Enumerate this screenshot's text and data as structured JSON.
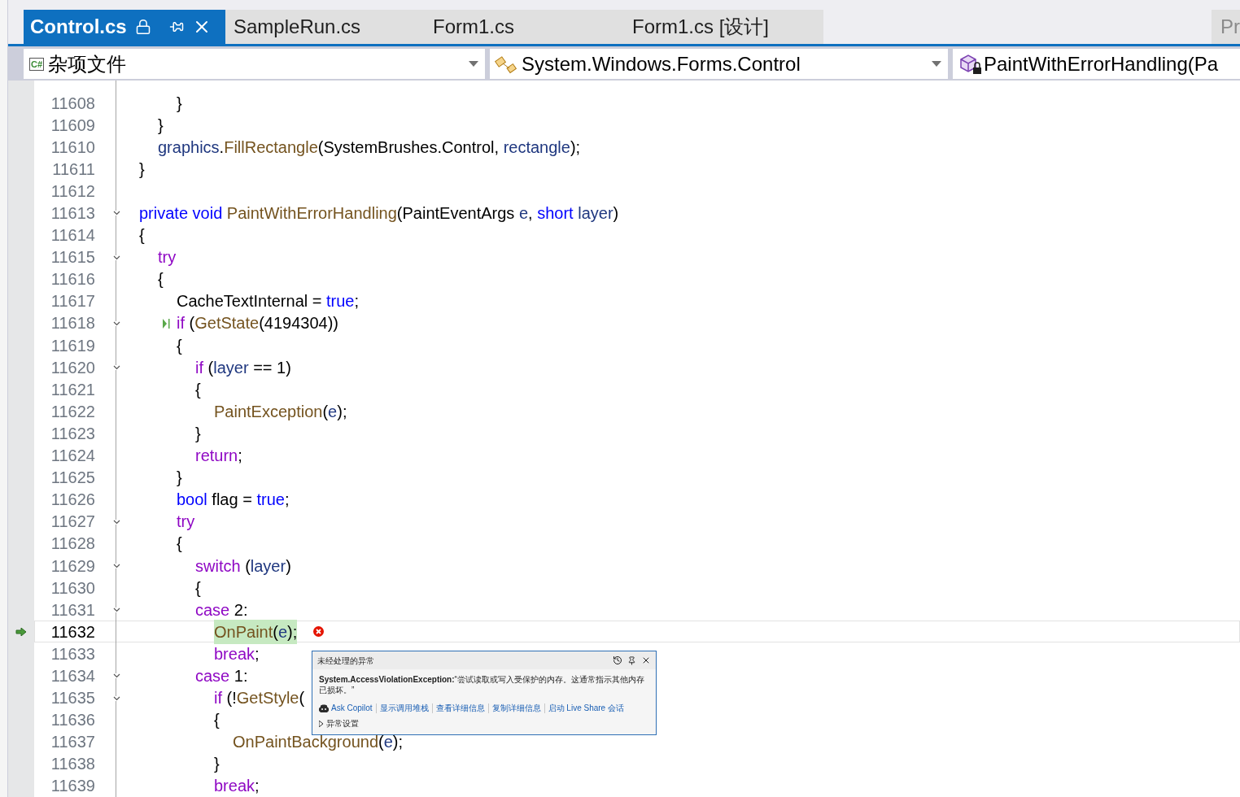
{
  "tabs": [
    {
      "label": "Control.cs",
      "selected": true
    },
    {
      "label": "SampleRun.cs",
      "selected": false
    },
    {
      "label": "Form1.cs",
      "selected": false
    },
    {
      "label": "Form1.cs [设计]",
      "selected": false
    }
  ],
  "side_tab": {
    "label": "Pr"
  },
  "nav_bar": {
    "project_badge": "C#",
    "project": "杂项文件",
    "type": "System.Windows.Forms.Control",
    "member": "PaintWithErrorHandling(Pa"
  },
  "lines": [
    {
      "children": [
        {
          "children": [
            {
              "number": "11608",
              "foldable": false,
              "current": false,
              "step_marker": false,
              "tokens": [
                {
                  "kind": "plain",
                  "text": "}"
                }
              ]
            }
          ]
        },
        {
          "number": "11609",
          "foldable": false,
          "current": false,
          "step_marker": false,
          "tokens": [
            {
              "kind": "plain",
              "text": "}"
            }
          ]
        },
        {
          "number": "11610",
          "foldable": false,
          "current": false,
          "step_marker": false,
          "tokens": [
            {
              "kind": "param",
              "text": "graphics"
            },
            {
              "kind": "plain",
              "text": "."
            },
            {
              "kind": "fn",
              "text": "FillRectangle"
            },
            {
              "kind": "plain",
              "text": "(SystemBrushes.Control, "
            },
            {
              "kind": "param",
              "text": "rectangle"
            },
            {
              "kind": "plain",
              "text": ");"
            }
          ]
        }
      ]
    },
    {
      "number": "11611",
      "foldable": false,
      "current": false,
      "step_marker": false,
      "tokens": [
        {
          "kind": "plain",
          "text": "}"
        }
      ]
    },
    {
      "number": "11612",
      "foldable": false,
      "current": false,
      "step_marker": false
    },
    {
      "number": "11613",
      "foldable": true,
      "current": false,
      "step_marker": false,
      "tokens": [
        {
          "kind": "kw",
          "text": "private void "
        },
        {
          "kind": "fn",
          "text": "PaintWithErrorHandling"
        },
        {
          "kind": "plain",
          "text": "(PaintEventArgs "
        },
        {
          "kind": "param",
          "text": "e"
        },
        {
          "kind": "plain",
          "text": ", "
        },
        {
          "kind": "kw",
          "text": "short "
        },
        {
          "kind": "param",
          "text": "layer"
        },
        {
          "kind": "plain",
          "text": ")"
        }
      ]
    },
    {
      "number": "11614",
      "foldable": false,
      "current": false,
      "step_marker": false,
      "tokens": [
        {
          "kind": "plain",
          "text": "{"
        }
      ],
      "children": [
        {
          "number": "11615",
          "foldable": true,
          "current": false,
          "step_marker": false,
          "tokens": [
            {
              "kind": "ctl",
              "text": "try"
            }
          ]
        },
        {
          "number": "11616",
          "foldable": false,
          "current": false,
          "step_marker": false,
          "tokens": [
            {
              "kind": "plain",
              "text": "{"
            }
          ],
          "children": [
            {
              "number": "11617",
              "foldable": false,
              "current": false,
              "step_marker": false,
              "tokens": [
                {
                  "kind": "plain",
                  "text": "CacheTextInternal = "
                },
                {
                  "kind": "kw",
                  "text": "true"
                },
                {
                  "kind": "plain",
                  "text": ";"
                }
              ]
            },
            {
              "number": "11618",
              "foldable": true,
              "current": false,
              "step_marker": true,
              "tokens": [
                {
                  "kind": "ctl",
                  "text": "if"
                },
                {
                  "kind": "plain",
                  "text": " ("
                },
                {
                  "kind": "fn",
                  "text": "GetState"
                },
                {
                  "kind": "plain",
                  "text": "(4194304))"
                }
              ]
            },
            {
              "number": "11619",
              "foldable": false,
              "current": false,
              "step_marker": false,
              "tokens": [
                {
                  "kind": "plain",
                  "text": "{"
                }
              ],
              "children": [
                {
                  "number": "11620",
                  "foldable": true,
                  "current": false,
                  "step_marker": false,
                  "tokens": [
                    {
                      "kind": "ctl",
                      "text": "if"
                    },
                    {
                      "kind": "plain",
                      "text": " ("
                    },
                    {
                      "kind": "param",
                      "text": "layer"
                    },
                    {
                      "kind": "plain",
                      "text": " == 1)"
                    }
                  ]
                },
                {
                  "number": "11621",
                  "foldable": false,
                  "current": false,
                  "step_marker": false,
                  "tokens": [
                    {
                      "kind": "plain",
                      "text": "{"
                    }
                  ],
                  "children": [
                    {
                      "number": "11622",
                      "foldable": false,
                      "current": false,
                      "step_marker": false,
                      "tokens": [
                        {
                          "kind": "fn",
                          "text": "PaintException"
                        },
                        {
                          "kind": "plain",
                          "text": "("
                        },
                        {
                          "kind": "param",
                          "text": "e"
                        },
                        {
                          "kind": "plain",
                          "text": ");"
                        }
                      ]
                    }
                  ]
                },
                {
                  "number": "11623",
                  "foldable": false,
                  "current": false,
                  "step_marker": false,
                  "tokens": [
                    {
                      "kind": "plain",
                      "text": "}"
                    }
                  ]
                },
                {
                  "number": "11624",
                  "foldable": false,
                  "current": false,
                  "step_marker": false,
                  "tokens": [
                    {
                      "kind": "ctl",
                      "text": "return"
                    },
                    {
                      "kind": "plain",
                      "text": ";"
                    }
                  ]
                }
              ]
            },
            {
              "number": "11625",
              "foldable": false,
              "current": false,
              "step_marker": false,
              "tokens": [
                {
                  "kind": "plain",
                  "text": "}"
                }
              ]
            },
            {
              "number": "11626",
              "foldable": false,
              "current": false,
              "step_marker": false,
              "tokens": [
                {
                  "kind": "kw",
                  "text": "bool"
                },
                {
                  "kind": "plain",
                  "text": " flag = "
                },
                {
                  "kind": "kw",
                  "text": "true"
                },
                {
                  "kind": "plain",
                  "text": ";"
                }
              ]
            },
            {
              "number": "11627",
              "foldable": true,
              "current": false,
              "step_marker": false,
              "tokens": [
                {
                  "kind": "ctl",
                  "text": "try"
                }
              ]
            },
            {
              "number": "11628",
              "foldable": false,
              "current": false,
              "step_marker": false,
              "tokens": [
                {
                  "kind": "plain",
                  "text": "{"
                }
              ],
              "children": [
                {
                  "number": "11629",
                  "foldable": true,
                  "current": false,
                  "step_marker": false,
                  "tokens": [
                    {
                      "kind": "ctl",
                      "text": "switch"
                    },
                    {
                      "kind": "plain",
                      "text": " ("
                    },
                    {
                      "kind": "param",
                      "text": "layer"
                    },
                    {
                      "kind": "plain",
                      "text": ")"
                    }
                  ]
                },
                {
                  "number": "11630",
                  "foldable": false,
                  "current": false,
                  "step_marker": false,
                  "tokens": [
                    {
                      "kind": "plain",
                      "text": "{"
                    }
                  ]
                },
                {
                  "number": "11631",
                  "foldable": true,
                  "current": false,
                  "step_marker": false,
                  "tokens": [
                    {
                      "kind": "ctl",
                      "text": "case"
                    },
                    {
                      "kind": "plain",
                      "text": " 2:"
                    }
                  ],
                  "children": [
                    {
                      "number": "11632",
                      "foldable": false,
                      "current": true,
                      "step_marker": false,
                      "tokens": [
                        {
                          "kind": "fn",
                          "text": "OnPaint"
                        },
                        {
                          "kind": "plain",
                          "text": "("
                        },
                        {
                          "kind": "param",
                          "text": "e"
                        },
                        {
                          "kind": "plain",
                          "text": ");"
                        }
                      ]
                    },
                    {
                      "number": "11633",
                      "foldable": false,
                      "current": false,
                      "step_marker": false,
                      "tokens": [
                        {
                          "kind": "ctl",
                          "text": "break"
                        },
                        {
                          "kind": "plain",
                          "text": ";"
                        }
                      ]
                    }
                  ]
                },
                {
                  "number": "11634",
                  "foldable": true,
                  "current": false,
                  "step_marker": false,
                  "tokens": [
                    {
                      "kind": "ctl",
                      "text": "case"
                    },
                    {
                      "kind": "plain",
                      "text": " 1:"
                    }
                  ],
                  "children": [
                    {
                      "number": "11635",
                      "foldable": true,
                      "current": false,
                      "step_marker": false,
                      "tokens": [
                        {
                          "kind": "ctl",
                          "text": "if"
                        },
                        {
                          "kind": "plain",
                          "text": " (!"
                        },
                        {
                          "kind": "fn",
                          "text": "GetStyle"
                        },
                        {
                          "kind": "plain",
                          "text": "("
                        }
                      ]
                    },
                    {
                      "number": "11636",
                      "foldable": false,
                      "current": false,
                      "step_marker": false,
                      "tokens": [
                        {
                          "kind": "plain",
                          "text": "{"
                        }
                      ],
                      "children": [
                        {
                          "number": "11637",
                          "foldable": false,
                          "current": false,
                          "step_marker": false,
                          "tokens": [
                            {
                              "kind": "fn",
                              "text": "OnPaintBackground"
                            },
                            {
                              "kind": "plain",
                              "text": "("
                            },
                            {
                              "kind": "param",
                              "text": "e"
                            },
                            {
                              "kind": "plain",
                              "text": ");"
                            }
                          ]
                        }
                      ]
                    },
                    {
                      "number": "11638",
                      "foldable": false,
                      "current": false,
                      "step_marker": false,
                      "tokens": [
                        {
                          "kind": "plain",
                          "text": "}"
                        }
                      ]
                    },
                    {
                      "number": "11639",
                      "foldable": false,
                      "current": false,
                      "step_marker": false,
                      "tokens": [
                        {
                          "kind": "ctl",
                          "text": "break"
                        },
                        {
                          "kind": "plain",
                          "text": ";"
                        }
                      ]
                    }
                  ]
                }
              ]
            }
          ]
        }
      ]
    }
  ],
  "exception_popup": {
    "title": "未经处理的异常",
    "message": "**System.AccessViolationException:**“尝试读取或写入受保护的内存。这通常指示其他内存已损坏。”",
    "actions": [
      {
        "label": "Ask Copilot",
        "kind": "copilot"
      },
      {
        "label": "显示调用堆栈",
        "kind": "link"
      },
      {
        "label": "查看详细信息",
        "kind": "link"
      },
      {
        "label": "复制详细信息",
        "kind": "link"
      },
      {
        "label": "启动 Live Share 会话",
        "kind": "link"
      }
    ],
    "settings": {
      "label": "异常设置",
      "expanded": false
    }
  }
}
